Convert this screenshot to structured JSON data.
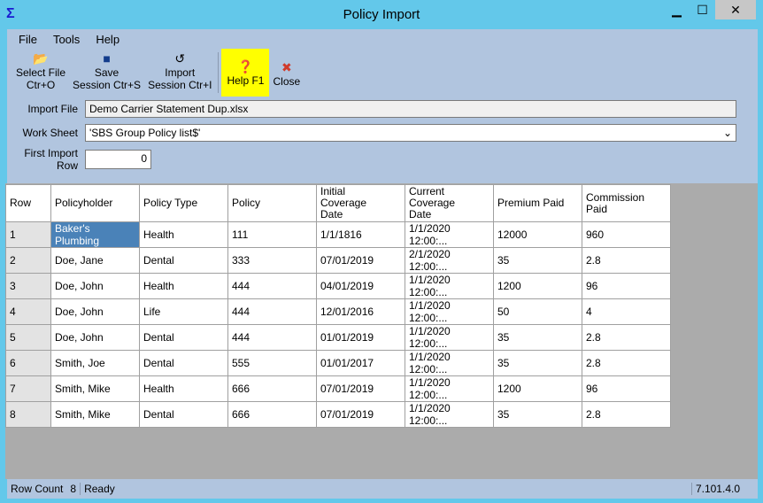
{
  "window": {
    "title": "Policy Import",
    "minimize": "▁",
    "maximize": "☐",
    "close": "✕"
  },
  "menu": [
    "File",
    "Tools",
    "Help"
  ],
  "toolbar": {
    "select_file": [
      "Select File",
      "Ctr+O"
    ],
    "save": [
      "Save",
      "Session Ctr+S"
    ],
    "import": [
      "Import",
      "Session Ctr+I"
    ],
    "help": "Help F1",
    "close": "Close"
  },
  "form": {
    "import_file_label": "Import File",
    "import_file": "Demo Carrier Statement Dup.xlsx",
    "work_sheet_label": "Work Sheet",
    "work_sheet": "'SBS Group Policy list$'",
    "first_row_label": "First Import Row",
    "first_row": "0"
  },
  "grid": {
    "columns": [
      "Row",
      "Policyholder",
      "Policy Type",
      "Policy",
      [
        "Initial",
        "Coverage",
        "Date"
      ],
      [
        "Current",
        "Coverage",
        "Date"
      ],
      "Premium Paid",
      [
        "Commission",
        "Paid"
      ]
    ],
    "rows": [
      [
        "1",
        "Baker's Plumbing",
        "Health",
        "111",
        "1/1/1816",
        "1/1/2020 12:00:...",
        "12000",
        "960"
      ],
      [
        "2",
        "Doe, Jane",
        "Dental",
        "333",
        "07/01/2019",
        "2/1/2020 12:00:...",
        "35",
        "2.8"
      ],
      [
        "3",
        "Doe, John",
        "Health",
        "444",
        "04/01/2019",
        "1/1/2020 12:00:...",
        "1200",
        "96"
      ],
      [
        "4",
        "Doe, John",
        "Life",
        "444",
        "12/01/2016",
        "1/1/2020 12:00:...",
        "50",
        "4"
      ],
      [
        "5",
        "Doe, John",
        "Dental",
        "444",
        "01/01/2019",
        "1/1/2020 12:00:...",
        "35",
        "2.8"
      ],
      [
        "6",
        "Smith, Joe",
        "Dental",
        "555",
        "01/01/2017",
        "1/1/2020 12:00:...",
        "35",
        "2.8"
      ],
      [
        "7",
        "Smith, Mike",
        "Health",
        "666",
        "07/01/2019",
        "1/1/2020 12:00:...",
        "1200",
        "96"
      ],
      [
        "8",
        "Smith, Mike",
        "Dental",
        "666",
        "07/01/2019",
        "1/1/2020 12:00:...",
        "35",
        "2.8"
      ]
    ]
  },
  "status": {
    "row_count_label": "Row Count",
    "row_count": "8",
    "state": "Ready",
    "version": "7.101.4.0"
  }
}
